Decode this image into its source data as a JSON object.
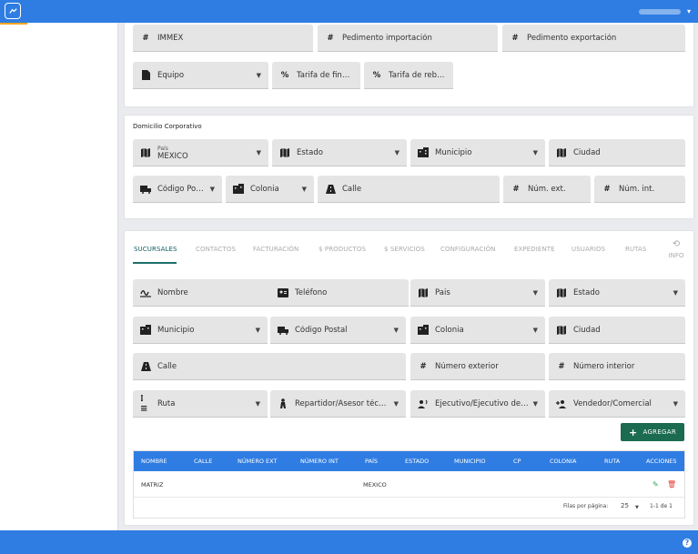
{
  "app": {
    "user_caret": "▾",
    "help": "?"
  },
  "top_fields": {
    "immex": "IMMEX",
    "ped_import": "Pedimento importación",
    "ped_export": "Pedimento exportación",
    "equipo": "Equipo",
    "tarifa_fin": "Tarifa de financi...",
    "tarifa_rebate": "Tarifa de rebate"
  },
  "domicilio": {
    "title": "Domicilio Corporativo",
    "pais_label": "País",
    "pais_value": "MEXICO",
    "estado": "Estado",
    "municipio": "Municipio",
    "ciudad": "Ciudad",
    "codigo_postal": "Código Post...",
    "colonia": "Colonia",
    "calle": "Calle",
    "num_ext": "Núm. ext.",
    "num_int": "Núm. int."
  },
  "tabs": {
    "sucursales": "SUCURSALES",
    "contactos": "CONTACTOS",
    "facturacion": "FACTURACIÓN",
    "productos": "$ PRODUCTOS",
    "servicios": "$ SERVICIOS",
    "configuracion": "CONFIGURACIÓN",
    "expediente": "EXPEDIENTE",
    "usuarios": "USUARIOS",
    "rutas": "RUTAS",
    "info": "INFO"
  },
  "sucursal_form": {
    "nombre": "Nombre",
    "telefono": "Teléfono",
    "pais": "Pais",
    "estado": "Estado",
    "municipio": "Municipio",
    "codigo_postal": "Código Postal",
    "colonia": "Colonia",
    "ciudad": "Ciudad",
    "calle": "Calle",
    "numero_exterior": "Número exterior",
    "numero_interior": "Número interior",
    "ruta": "Ruta",
    "repartidor": "Repartidor/Asesor técnico",
    "ejecutivo": "Ejecutivo/Ejecutivo de cue...",
    "vendedor": "Vendedor/Comercial",
    "agregar": "AGREGAR"
  },
  "table": {
    "headers": [
      "NOMBRE",
      "CALLE",
      "NÚMERO EXT",
      "NÚMERO INT",
      "PAÍS",
      "ESTADO",
      "MUNICIPIO",
      "CP",
      "COLONIA",
      "RUTA",
      "ACCIONES"
    ],
    "row": {
      "nombre": "MATRIZ",
      "pais": "MEXICO"
    },
    "filas_label": "Filas por página:",
    "filas_value": "25",
    "range": "1-1 de 1"
  },
  "colors": {
    "primary": "#2f7de2",
    "accent_green": "#1b6b50",
    "delete": "#e53935",
    "edit": "#2e9e4f"
  }
}
